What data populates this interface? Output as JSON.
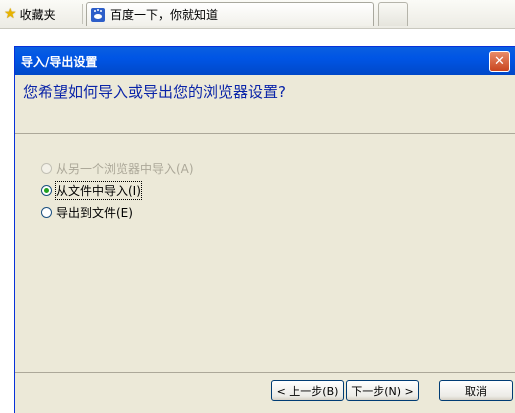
{
  "topbar": {
    "favorites_label": "收藏夹",
    "tab_title": "百度一下，你就知道"
  },
  "dialog": {
    "title": "导入/导出设置",
    "close_glyph": "✕",
    "question": "您希望如何导入或导出您的浏览器设置?",
    "options": [
      {
        "label": "从另一个浏览器中导入(A)",
        "state": "disabled"
      },
      {
        "label": "从文件中导入(I)",
        "state": "selected"
      },
      {
        "label": "导出到文件(E)",
        "state": "unselected"
      }
    ],
    "buttons": {
      "back": "< 上一步(B)",
      "next": "下一步(N) >",
      "cancel": "取消"
    }
  },
  "colors": {
    "titlebar": "#0055e5",
    "question_text": "#0a24a8",
    "dialog_bg": "#ece9d8"
  },
  "icons": {
    "favorites": "star-icon",
    "tab": "paw-icon",
    "close": "close-icon"
  }
}
